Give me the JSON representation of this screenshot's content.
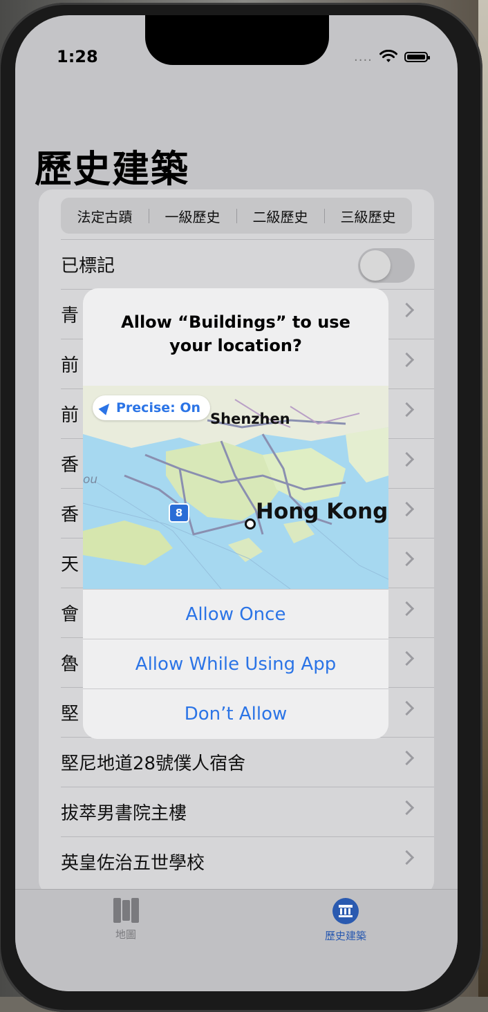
{
  "status_bar": {
    "time": "1:28",
    "signal": "....",
    "wifi_icon": "wifi-icon",
    "battery_icon": "battery-icon"
  },
  "page": {
    "title": "歷史建築"
  },
  "segments": [
    "法定古蹟",
    "一級歷史",
    "二級歷史",
    "三級歷史"
  ],
  "toggle_row": {
    "label": "已標記",
    "on": false
  },
  "list_items": [
    {
      "label": "青"
    },
    {
      "label": "前"
    },
    {
      "label": "前"
    },
    {
      "label": "香"
    },
    {
      "label": "香"
    },
    {
      "label": "天"
    },
    {
      "label": "會"
    },
    {
      "label": "魯"
    },
    {
      "label": "堅"
    },
    {
      "label": "堅尼地道28號僕人宿舍"
    },
    {
      "label": "拔萃男書院主樓"
    },
    {
      "label": "英皇佐治五世學校"
    }
  ],
  "alert": {
    "title": "Allow “Buildings” to use your location?",
    "precise_label": "Precise: On",
    "map_labels": {
      "shenzhen": "Shenzhen",
      "hong_kong": "Hong Kong",
      "route": "8",
      "left_partial": "ou"
    },
    "buttons": {
      "allow_once": "Allow Once",
      "allow_while_using": "Allow While Using App",
      "dont_allow": "Don’t Allow"
    }
  },
  "tabs": [
    {
      "label": "地圖",
      "icon": "map-icon",
      "selected": false
    },
    {
      "label": "歷史建築",
      "icon": "bank-icon",
      "selected": true
    }
  ],
  "colors": {
    "accent": "#2b74e6",
    "selected_tab": "#2a5ab0",
    "unselected_tab": "#7a7a7e"
  }
}
